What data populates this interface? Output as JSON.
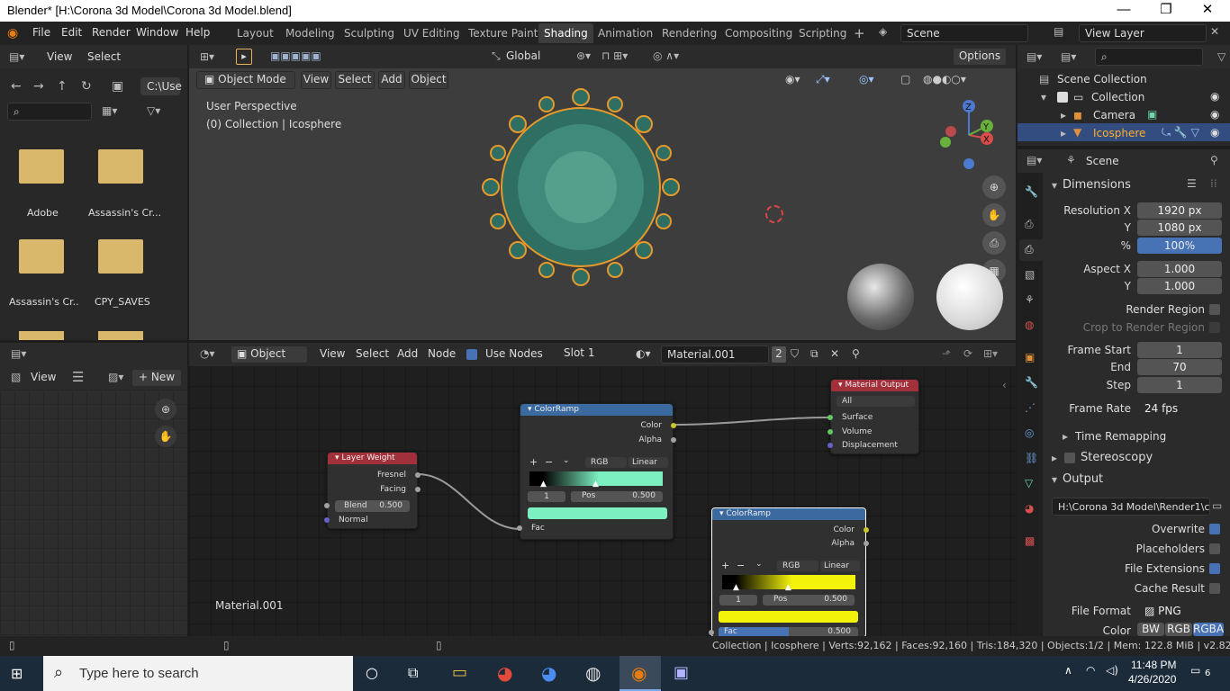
{
  "window": {
    "title": "Blender* [H:\\Corona 3d Model\\Corona 3d Model.blend]",
    "minimize": "—",
    "restore": "❐",
    "close": "✕"
  },
  "topmenu": [
    "File",
    "Edit",
    "Render",
    "Window",
    "Help"
  ],
  "workspaces": [
    "Layout",
    "Modeling",
    "Sculpting",
    "UV Editing",
    "Texture Paint",
    "Shading",
    "Animation",
    "Rendering",
    "Compositing",
    "Scripting"
  ],
  "active_workspace": "Shading",
  "scene_name": "Scene",
  "view_layer": "View Layer",
  "filebrowser": {
    "view": "View",
    "select": "Select",
    "path": "C:\\Use",
    "items": [
      "Adobe",
      "Assassin's Cr...",
      "Assassin's Cr..",
      "CPY_SAVES"
    ]
  },
  "viewport": {
    "orientation": "Global",
    "options": "Options",
    "mode": "Object Mode",
    "menus": [
      "View",
      "Select",
      "Add",
      "Object"
    ],
    "overlay1": "User Perspective",
    "overlay2": "(0) Collection | Icosphere",
    "gizmo": {
      "z": "Z",
      "y": "Y",
      "x": "X"
    }
  },
  "image_editor": {
    "view": "View",
    "new": "New"
  },
  "node_editor": {
    "type": "Object",
    "menus": [
      "View",
      "Select",
      "Add",
      "Node"
    ],
    "use_nodes": "Use Nodes",
    "slot": "Slot 1",
    "material": "Material.001",
    "users": "2",
    "footer_label": "Material.001"
  },
  "nodes": {
    "layer_weight": {
      "title": "Layer Weight",
      "fresnel": "Fresnel",
      "facing": "Facing",
      "blend_label": "Blend",
      "blend_value": "0.500",
      "normal": "Normal"
    },
    "colorramp1": {
      "title": "ColorRamp",
      "color": "Color",
      "alpha": "Alpha",
      "mode": "RGB",
      "interp": "Linear",
      "index": "1",
      "pos_label": "Pos",
      "pos_value": "0.500",
      "fac": "Fac",
      "plus": "+",
      "minus": "−"
    },
    "material_output": {
      "title": "Material Output",
      "target": "All",
      "surface": "Surface",
      "volume": "Volume",
      "displacement": "Displacement"
    },
    "colorramp2": {
      "title": "ColorRamp",
      "color": "Color",
      "alpha": "Alpha",
      "mode": "RGB",
      "interp": "Linear",
      "index": "1",
      "pos_label": "Pos",
      "pos_value": "0.500",
      "fac": "Fac",
      "fac_value": "0.500",
      "plus": "+",
      "minus": "−"
    }
  },
  "outliner": {
    "root": "Scene Collection",
    "collection": "Collection",
    "camera": "Camera",
    "icosphere": "Icosphere"
  },
  "properties": {
    "context": "Scene",
    "dimensions": "Dimensions",
    "res_x_label": "Resolution X",
    "res_x": "1920 px",
    "res_y_label": "Y",
    "res_y": "1080 px",
    "pct_label": "%",
    "pct": "100%",
    "aspect_x_label": "Aspect X",
    "aspect_x": "1.000",
    "aspect_y_label": "Y",
    "aspect_y": "1.000",
    "render_region": "Render Region",
    "crop_region": "Crop to Render Region",
    "frame_start_label": "Frame Start",
    "frame_start": "1",
    "end_label": "End",
    "end": "70",
    "step_label": "Step",
    "step": "1",
    "frame_rate_label": "Frame Rate",
    "frame_rate": "24 fps",
    "time_remap": "Time Remapping",
    "stereoscopy": "Stereoscopy",
    "output": "Output",
    "output_path": "H:\\Corona 3d Model\\Render1\\c...",
    "overwrite": "Overwrite",
    "placeholders": "Placeholders",
    "file_ext": "File Extensions",
    "cache": "Cache Result",
    "file_format_label": "File Format",
    "file_format": "PNG",
    "color_label": "Color",
    "color_bw": "BW",
    "color_rgb": "RGB",
    "color_rgba": "RGBA"
  },
  "statusbar": "Collection | Icosphere | Verts:92,162 | Faces:92,160 | Tris:184,320 | Objects:1/2 | Mem: 122.8 MiB | v2.82.7",
  "taskbar": {
    "search": "Type here to search",
    "time": "11:48 PM",
    "date": "4/26/2020",
    "notif": "6"
  },
  "colors": {
    "accent": "#4772b3",
    "node_header_blue": "#3b6aa0",
    "node_header_red": "#a1303a",
    "socket_yellow": "#c7c729",
    "socket_grey": "#a1a1a1",
    "socket_purple": "#6363c7",
    "socket_green": "#63c763"
  }
}
